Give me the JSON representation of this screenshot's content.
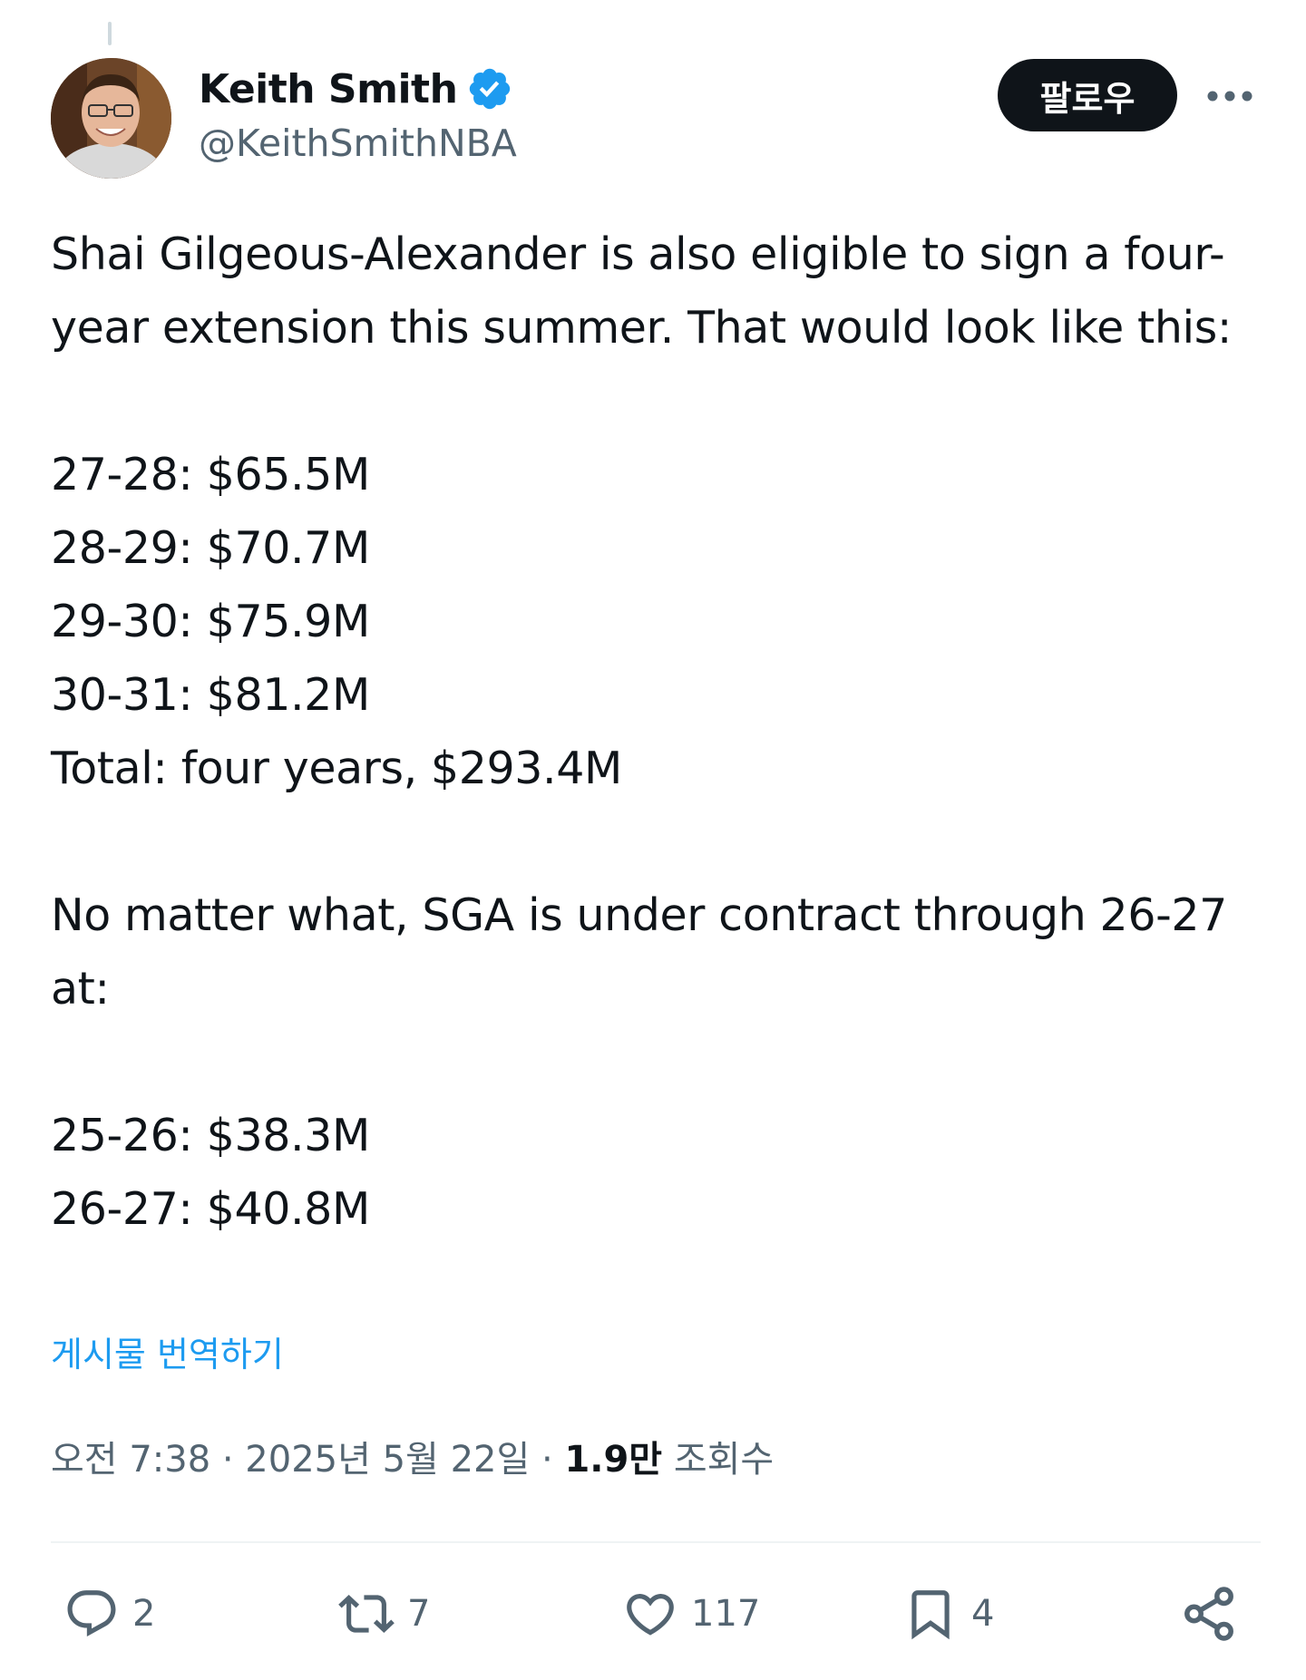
{
  "author": {
    "display_name": "Keith Smith",
    "handle": "@KeithSmithNBA",
    "verified": true,
    "verified_color": "#1d9bf0"
  },
  "header": {
    "follow_label": "팔로우",
    "more_icon": "more-icon"
  },
  "tweet": {
    "text": "Shai Gilgeous-Alexander is also eligible to sign a four-year extension this summer. That would look like this:\n\n27-28: $65.5M\n28-29: $70.7M\n29-30: $75.9M\n30-31: $81.2M\nTotal: four years, $293.4M\n\nNo matter what, SGA is under contract through 26-27 at:\n\n25-26: $38.3M\n26-27: $40.8M",
    "translate_label": "게시물 번역하기"
  },
  "meta": {
    "time": "오전 7:38",
    "separator": " · ",
    "date": "2025년 5월 22일",
    "views_count": "1.9만",
    "views_label": "조회수"
  },
  "actions": {
    "replies": "2",
    "retweets": "7",
    "likes": "117",
    "bookmarks": "4"
  },
  "colors": {
    "text": "#0f1419",
    "secondary": "#536471",
    "link": "#1d9bf0"
  }
}
